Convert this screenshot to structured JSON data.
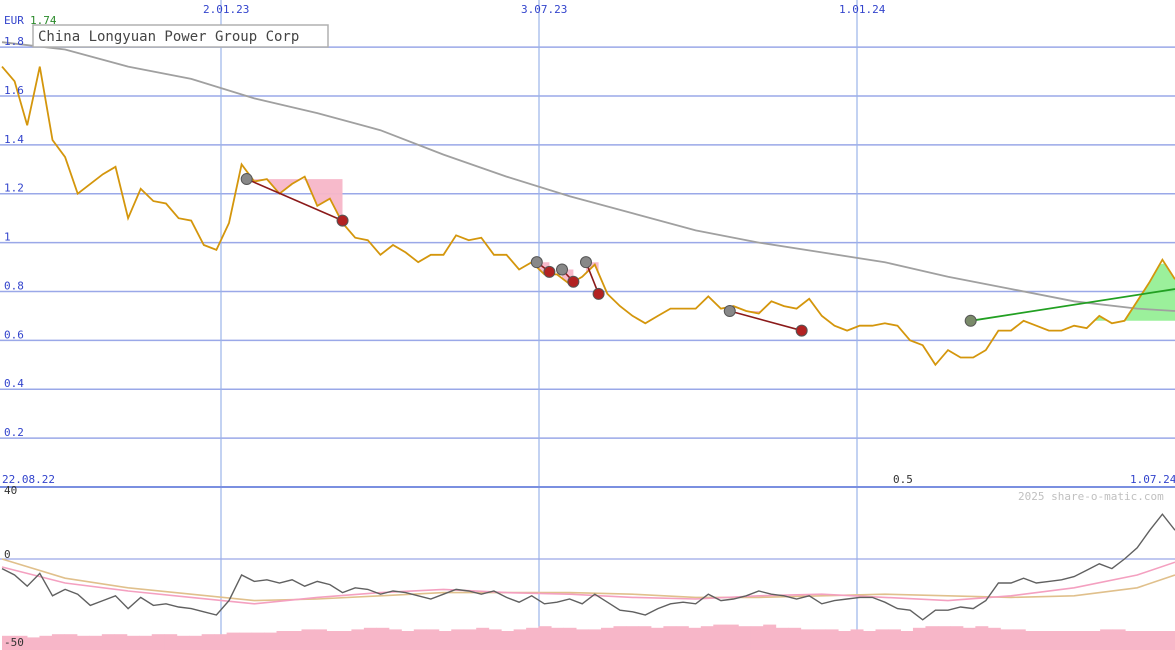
{
  "colors": {
    "price": "#d4960c",
    "ma": "#a0a0a0",
    "grid_h": "#9aa8e8",
    "grid_v": "#9bb4e8",
    "divider": "#7a8fe0",
    "axis_text": "#3344cc",
    "bear_fill": "#f7b6c8",
    "bull_fill": "#90ee90",
    "bear_line": "#8b1a1a",
    "bull_line": "#22a022",
    "osc_main": "#606060",
    "osc_pink": "#f4a0c0",
    "osc_tan": "#e0c08c",
    "hist": "#f7b6c8"
  },
  "header": {
    "currency": "EUR",
    "last_value": "1.74",
    "title": "China Longyuan Power Group Corp"
  },
  "footer": {
    "start_date": "22.08.22",
    "end_date": "1.07.24",
    "level": "0.5",
    "watermark": "2025 share-o-matic.com"
  },
  "chart_data": [
    {
      "type": "line",
      "title": "China Longyuan Power Group Corp",
      "ylabel": "EUR",
      "ylim": [
        0,
        1.8
      ],
      "y_ticks": [
        0.2,
        0.4,
        0.6,
        0.8,
        1,
        1.2,
        1.4,
        1.6,
        1.8
      ],
      "x_ticks": [
        "2.01.23",
        "3.07.23",
        "1.01.24"
      ],
      "x_range": [
        "22.08.22",
        "1.07.24"
      ],
      "grid": true,
      "series": [
        {
          "role": "price",
          "x": [
            0,
            1,
            2,
            3,
            4,
            5,
            6,
            7,
            8,
            9,
            10,
            11,
            12,
            13,
            14,
            15,
            16,
            17,
            18,
            19,
            20,
            21,
            22,
            23,
            24,
            25,
            26,
            27,
            28,
            29,
            30,
            31,
            32,
            33,
            34,
            35,
            36,
            37,
            38,
            39,
            40,
            41,
            42,
            43,
            44,
            45,
            46,
            47,
            48,
            49,
            50,
            51,
            52,
            53,
            54,
            55,
            56,
            57,
            58,
            59,
            60,
            61,
            62,
            63,
            64,
            65,
            66,
            67,
            68,
            69,
            70,
            71,
            72,
            73,
            74,
            75,
            76,
            77,
            78,
            79,
            80,
            81,
            82,
            83,
            84,
            85,
            86,
            87,
            88,
            89,
            90,
            91,
            92,
            93
          ],
          "y": [
            1.72,
            1.66,
            1.48,
            1.72,
            1.42,
            1.35,
            1.2,
            1.24,
            1.28,
            1.31,
            1.1,
            1.22,
            1.17,
            1.16,
            1.1,
            1.09,
            0.99,
            0.97,
            1.08,
            1.32,
            1.25,
            1.26,
            1.2,
            1.24,
            1.27,
            1.15,
            1.18,
            1.08,
            1.02,
            1.01,
            0.95,
            0.99,
            0.96,
            0.92,
            0.95,
            0.95,
            1.03,
            1.01,
            1.02,
            0.95,
            0.95,
            0.89,
            0.92,
            0.87,
            0.87,
            0.83,
            0.86,
            0.91,
            0.79,
            0.74,
            0.7,
            0.67,
            0.7,
            0.73,
            0.73,
            0.73,
            0.78,
            0.73,
            0.74,
            0.72,
            0.71,
            0.76,
            0.74,
            0.73,
            0.77,
            0.7,
            0.66,
            0.64,
            0.66,
            0.66,
            0.67,
            0.66,
            0.6,
            0.58,
            0.5,
            0.56,
            0.53,
            0.53,
            0.56,
            0.64,
            0.64,
            0.68,
            0.66,
            0.64,
            0.64,
            0.66,
            0.65,
            0.7,
            0.67,
            0.68,
            0.76,
            0.84,
            0.93,
            0.85
          ]
        },
        {
          "role": "moving-average",
          "x": [
            0,
            5,
            10,
            15,
            20,
            25,
            30,
            35,
            40,
            45,
            50,
            55,
            60,
            65,
            70,
            75,
            80,
            85,
            90,
            93
          ],
          "y": [
            1.82,
            1.79,
            1.72,
            1.67,
            1.59,
            1.53,
            1.46,
            1.36,
            1.27,
            1.19,
            1.12,
            1.05,
            1.0,
            0.96,
            0.92,
            0.86,
            0.81,
            0.76,
            0.73,
            0.72
          ]
        }
      ],
      "bearish_trendlines": [
        {
          "x1": 19.4,
          "y1": 1.26,
          "x2": 27.0,
          "y2": 1.09
        },
        {
          "x1": 42.4,
          "y1": 0.92,
          "x2": 43.4,
          "y2": 0.88
        },
        {
          "x1": 44.4,
          "y1": 0.89,
          "x2": 45.3,
          "y2": 0.84
        },
        {
          "x1": 46.3,
          "y1": 0.92,
          "x2": 47.3,
          "y2": 0.79
        },
        {
          "x1": 57.7,
          "y1": 0.72,
          "x2": 63.4,
          "y2": 0.64
        }
      ],
      "bullish_trendlines": [
        {
          "x1": 76.8,
          "y1": 0.68,
          "x2": 93,
          "y2": 0.81
        }
      ]
    },
    {
      "type": "line",
      "ylim": [
        -50,
        40
      ],
      "y_ticks": [
        40,
        0,
        -50
      ],
      "series": [
        {
          "role": "oscillator",
          "x": [
            0,
            1,
            2,
            3,
            4,
            5,
            6,
            7,
            8,
            9,
            10,
            11,
            12,
            13,
            14,
            15,
            16,
            17,
            18,
            19,
            20,
            21,
            22,
            23,
            24,
            25,
            26,
            27,
            28,
            29,
            30,
            31,
            32,
            33,
            34,
            35,
            36,
            37,
            38,
            39,
            40,
            41,
            42,
            43,
            44,
            45,
            46,
            47,
            48,
            49,
            50,
            51,
            52,
            53,
            54,
            55,
            56,
            57,
            58,
            59,
            60,
            61,
            62,
            63,
            64,
            65,
            66,
            67,
            68,
            69,
            70,
            71,
            72,
            73,
            74,
            75,
            76,
            77,
            78,
            79,
            80,
            81,
            82,
            83,
            84,
            85,
            86,
            87,
            88,
            89,
            90,
            91,
            92,
            93
          ],
          "y": [
            -6,
            -10,
            -17,
            -9,
            -23,
            -19,
            -22,
            -29,
            -26,
            -23,
            -31,
            -24,
            -29,
            -28,
            -30,
            -31,
            -33,
            -35,
            -26,
            -10,
            -14,
            -13,
            -15,
            -13,
            -17,
            -14,
            -16,
            -21,
            -18,
            -19,
            -22,
            -20,
            -21,
            -23,
            -25,
            -22,
            -19,
            -20,
            -22,
            -20,
            -24,
            -27,
            -23,
            -28,
            -27,
            -25,
            -28,
            -22,
            -27,
            -32,
            -33,
            -35,
            -31,
            -28,
            -27,
            -28,
            -22,
            -26,
            -25,
            -23,
            -20,
            -22,
            -23,
            -25,
            -23,
            -28,
            -26,
            -25,
            -24,
            -24,
            -27,
            -31,
            -32,
            -38,
            -32,
            -32,
            -30,
            -31,
            -26,
            -15,
            -15,
            -12,
            -15,
            -14,
            -13,
            -11,
            -7,
            -3,
            -6,
            0,
            7,
            18,
            28,
            18
          ]
        },
        {
          "role": "signal",
          "x": [
            0,
            5,
            10,
            15,
            20,
            25,
            30,
            35,
            40,
            45,
            50,
            55,
            60,
            65,
            70,
            75,
            80,
            85,
            90,
            93
          ],
          "y": [
            -5,
            -15,
            -20,
            -24,
            -28,
            -24,
            -21,
            -19,
            -21,
            -22,
            -24,
            -25,
            -23,
            -22,
            -24,
            -26,
            -23,
            -18,
            -10,
            -2
          ]
        },
        {
          "role": "slow-signal",
          "x": [
            0,
            5,
            10,
            15,
            20,
            25,
            30,
            35,
            40,
            45,
            50,
            55,
            60,
            65,
            70,
            75,
            80,
            85,
            90,
            93
          ],
          "y": [
            0,
            -12,
            -18,
            -22,
            -26,
            -25,
            -23,
            -21,
            -21,
            -21,
            -22,
            -24,
            -24,
            -23,
            -22,
            -23,
            -24,
            -23,
            -18,
            -10
          ]
        }
      ],
      "histogram": [
        -48,
        -48,
        -49,
        -48,
        -47,
        -47,
        -48,
        -48,
        -47,
        -47,
        -48,
        -48,
        -47,
        -47,
        -48,
        -48,
        -47,
        -47,
        -46,
        -46,
        -46,
        -46,
        -45,
        -45,
        -44,
        -44,
        -45,
        -45,
        -44,
        -43,
        -43,
        -44,
        -45,
        -44,
        -44,
        -45,
        -44,
        -44,
        -43,
        -44,
        -45,
        -44,
        -43,
        -42,
        -43,
        -43,
        -44,
        -44,
        -43,
        -42,
        -42,
        -42,
        -43,
        -42,
        -42,
        -43,
        -42,
        -41,
        -41,
        -42,
        -42,
        -41,
        -43,
        -43,
        -44,
        -44,
        -44,
        -45,
        -44,
        -45,
        -44,
        -44,
        -45,
        -43,
        -42,
        -42,
        -42,
        -43,
        -42,
        -43,
        -44,
        -44,
        -45,
        -45,
        -45,
        -45,
        -45,
        -45,
        -44,
        -44,
        -45,
        -45,
        -45,
        -45
      ]
    }
  ]
}
